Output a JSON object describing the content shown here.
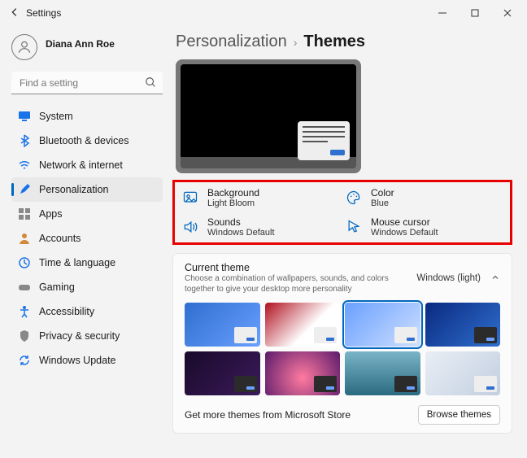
{
  "window": {
    "title": "Settings"
  },
  "user": {
    "name": "Diana Ann Roe"
  },
  "search": {
    "placeholder": "Find a setting"
  },
  "sidebar": {
    "items": [
      {
        "label": "System",
        "color": "#0067c0"
      },
      {
        "label": "Bluetooth & devices",
        "color": "#0067c0"
      },
      {
        "label": "Network & internet",
        "color": "#0067c0"
      },
      {
        "label": "Personalization",
        "color": "#0067c0",
        "active": true
      },
      {
        "label": "Apps",
        "color": "#7a7a7a"
      },
      {
        "label": "Accounts",
        "color": "#d08a3a"
      },
      {
        "label": "Time & language",
        "color": "#0067c0"
      },
      {
        "label": "Gaming",
        "color": "#7a7a7a"
      },
      {
        "label": "Accessibility",
        "color": "#0067c0"
      },
      {
        "label": "Privacy & security",
        "color": "#7a7a7a"
      },
      {
        "label": "Windows Update",
        "color": "#0067c0"
      }
    ]
  },
  "breadcrumb": {
    "parent": "Personalization",
    "current": "Themes"
  },
  "theme_options": {
    "background": {
      "title": "Background",
      "value": "Light Bloom"
    },
    "color": {
      "title": "Color",
      "value": "Blue"
    },
    "sounds": {
      "title": "Sounds",
      "value": "Windows Default"
    },
    "cursor": {
      "title": "Mouse cursor",
      "value": "Windows Default"
    }
  },
  "current_theme": {
    "title": "Current theme",
    "desc": "Choose a combination of wallpapers, sounds, and colors together to give your desktop more personality",
    "value": "Windows (light)"
  },
  "store": {
    "label": "Get more themes from Microsoft Store",
    "button": "Browse themes"
  },
  "thumbs": [
    {
      "bg": "linear-gradient(135deg,#2f6fcf,#6aa0ff)",
      "dark": false,
      "sel": false
    },
    {
      "bg": "linear-gradient(135deg,#b01020,#ffffff 60%)",
      "dark": false,
      "sel": false
    },
    {
      "bg": "linear-gradient(135deg,#6aa0ff,#cfe0ff)",
      "dark": false,
      "sel": true
    },
    {
      "bg": "linear-gradient(135deg,#0a2a80,#2f6fcf)",
      "dark": true,
      "sel": false
    },
    {
      "bg": "linear-gradient(135deg,#1a0a2a,#3a1a5a)",
      "dark": true,
      "sel": false
    },
    {
      "bg": "radial-gradient(circle at 50% 60%,#ff7aa0,#5a1a6a)",
      "dark": true,
      "sel": false
    },
    {
      "bg": "linear-gradient(180deg,#7ab4c8,#2a6a80)",
      "dark": true,
      "sel": false
    },
    {
      "bg": "linear-gradient(135deg,#e9eef5,#c2cfe0)",
      "dark": false,
      "sel": false
    }
  ]
}
